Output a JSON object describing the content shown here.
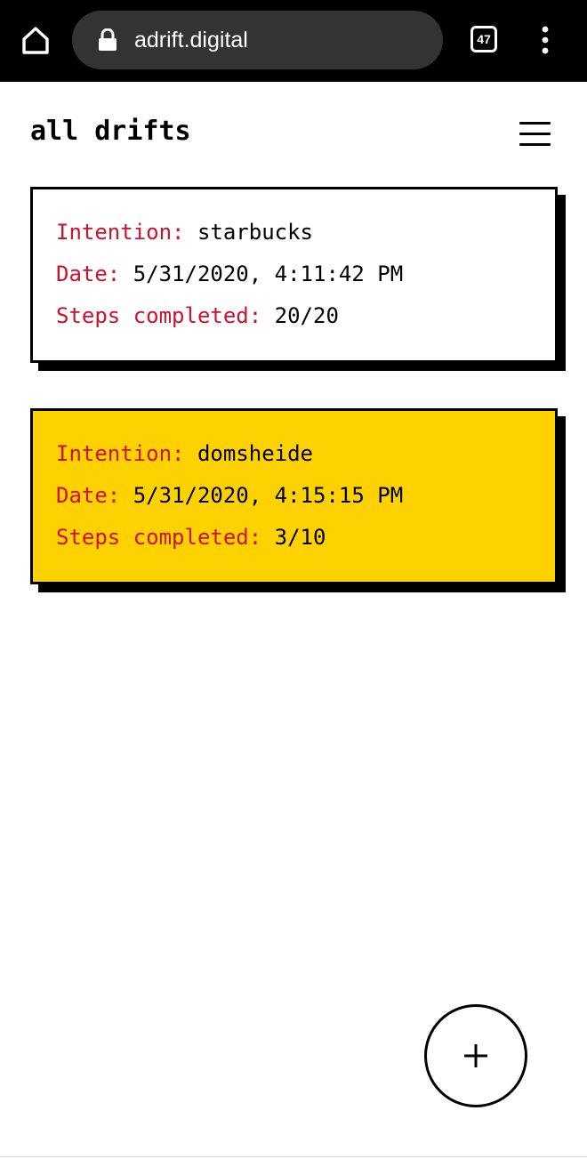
{
  "browser": {
    "url": "adrift.digital",
    "tab_count": "47",
    "icons": {
      "home": "home-icon",
      "lock": "lock-icon",
      "tabs": "tab-switcher-icon",
      "more": "more-vertical-icon"
    }
  },
  "page": {
    "title": "all drifts",
    "menu_icon": "hamburger-menu-icon"
  },
  "labels": {
    "intention": "Intention:",
    "date": "Date:",
    "steps": "Steps completed:"
  },
  "drifts": [
    {
      "intention": "starbucks",
      "date": "5/31/2020, 4:11:42 PM",
      "steps": "20/20",
      "background": "#ffffff"
    },
    {
      "intention": "domsheide",
      "date": "5/31/2020, 4:15:15 PM",
      "steps": "3/10",
      "background": "#fdd200"
    }
  ],
  "fab": {
    "icon": "plus-icon"
  },
  "colors": {
    "accent_label": "#d0112b",
    "highlight": "#fdd200",
    "browser_bar": "#000000",
    "url_pill": "#333333"
  }
}
